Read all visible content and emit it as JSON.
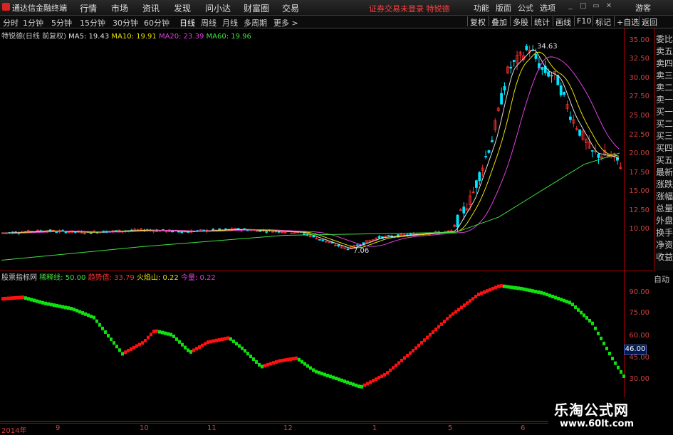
{
  "titlebar": {
    "app_name": "通达信金融终端",
    "menus": [
      "行情",
      "市场",
      "资讯",
      "发现",
      "问小达",
      "财富圈",
      "交易"
    ],
    "notice": "证券交易未登录  特锐德",
    "right_menus": [
      "功能",
      "版面",
      "公式",
      "选项"
    ],
    "guest": "游客"
  },
  "periodbar": {
    "periods": [
      "分时",
      "1分钟",
      "5分钟",
      "15分钟",
      "30分钟",
      "60分钟",
      "日线",
      "周线",
      "月线",
      "多周期",
      "更多 >"
    ],
    "active": "日线",
    "tools": [
      "复权",
      "叠加",
      "多股",
      "统计",
      "画线",
      "F10",
      "标记",
      "+自选",
      "返回"
    ]
  },
  "main_info": {
    "stock": "特锐德(日线 前复权)",
    "ma5": "MA5: 19.43",
    "ma10": "MA10: 19.91",
    "ma20": "MA20: 23.39",
    "ma60": "MA60: 19.96"
  },
  "sub_info": {
    "name": "股票指标网",
    "l1": "稀释线: 50.00",
    "l2": "趋势值: 33.79",
    "l3": "火焰山: 0.22",
    "l4": "今量: 0.22"
  },
  "right_panel": [
    "委比",
    "卖五",
    "卖四",
    "卖三",
    "卖二",
    "卖一",
    "买一",
    "买二",
    "买三",
    "买四",
    "买五",
    "最新",
    "涨跌",
    "涨幅",
    "总量",
    "外盘",
    "换手",
    "净资",
    "收益"
  ],
  "auto_label": "自动",
  "price_axis": [
    "35.00",
    "32.50",
    "30.00",
    "27.50",
    "25.00",
    "22.50",
    "20.00",
    "17.50",
    "15.00",
    "12.50",
    "10.00"
  ],
  "osc_axis": [
    "90.00",
    "75.00",
    "60.00",
    "45.00",
    "30.00"
  ],
  "osc_current": "46.00",
  "annotations": {
    "high": "34.63",
    "low": "7.06"
  },
  "dates": [
    "2014年",
    "9",
    "10",
    "11",
    "12",
    "1",
    "5",
    "6"
  ],
  "watermark": {
    "line1": "乐淘公式网",
    "line2": "www.60lt.com"
  },
  "colors": {
    "up": "#ff3030",
    "down": "#00e5ff",
    "ma5": "#e0e0e0",
    "ma10": "#e8e000",
    "ma20": "#e040e0",
    "ma60": "#40e040",
    "osc_up": "#ff1010",
    "osc_down": "#10e010"
  }
}
